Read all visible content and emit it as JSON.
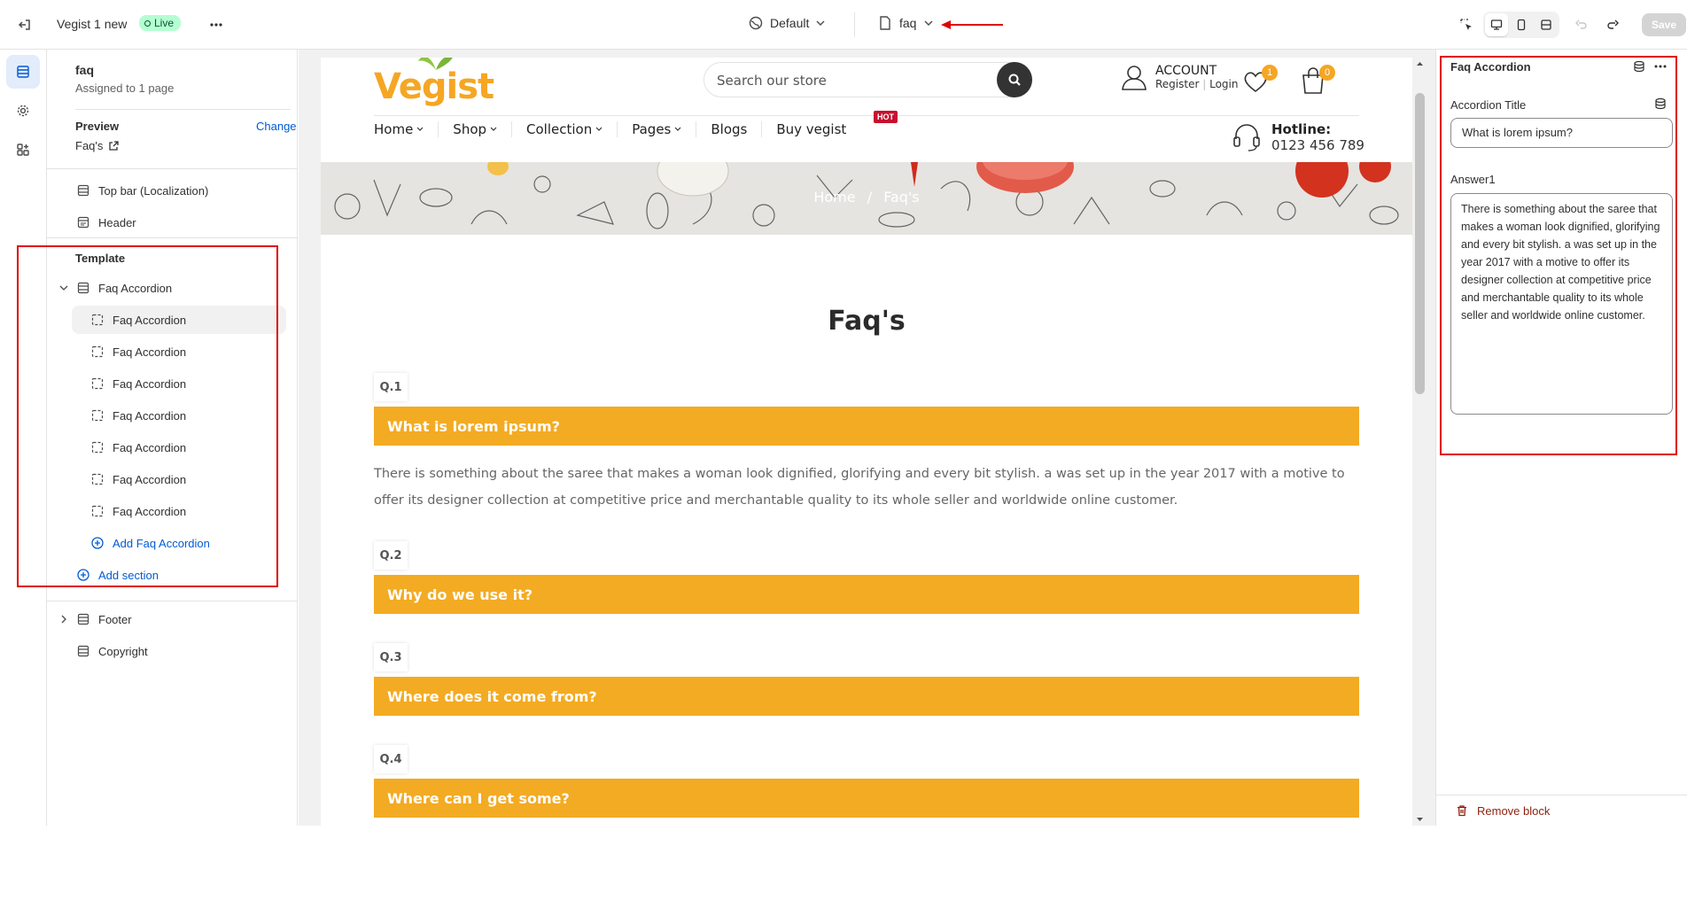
{
  "topbar": {
    "theme_name": "Vegist 1 new",
    "live_label": "Live",
    "language_label": "Default",
    "page_label": "faq",
    "save_label": "Save"
  },
  "sections_panel": {
    "page_title": "faq",
    "assigned": "Assigned to 1 page",
    "preview_label": "Preview",
    "change_label": "Change",
    "preview_page": "Faq's",
    "top_bar": "Top bar (Localization)",
    "header": "Header",
    "template_label": "Template",
    "section_name": "Faq Accordion",
    "blocks": [
      "Faq Accordion",
      "Faq Accordion",
      "Faq Accordion",
      "Faq Accordion",
      "Faq Accordion",
      "Faq Accordion",
      "Faq Accordion"
    ],
    "add_block": "Add Faq Accordion",
    "add_section": "Add section",
    "footer": "Footer",
    "copyright": "Copyright"
  },
  "store": {
    "logo": "Vegist",
    "search_placeholder": "Search our store",
    "account_title": "ACCOUNT",
    "register": "Register",
    "login": "Login",
    "wishlist_count": "1",
    "cart_count": "0",
    "nav": [
      "Home",
      "Shop",
      "Collection",
      "Pages",
      "Blogs",
      "Buy vegist"
    ],
    "hot_badge": "HOT",
    "hotline_title": "Hotline:",
    "hotline_number": "0123 456 789",
    "breadcrumb_home": "Home",
    "breadcrumb_sep": "/",
    "breadcrumb_current": "Faq's",
    "faq_title": "Faq's",
    "questions": [
      {
        "label": "Q.1",
        "title": "What is lorem ipsum?"
      },
      {
        "label": "Q.2",
        "title": "Why do we use it?"
      },
      {
        "label": "Q.3",
        "title": "Where does it come from?"
      },
      {
        "label": "Q.4",
        "title": "Where can I get some?"
      }
    ],
    "answer1": "There is something about the saree that makes a woman look dignified, glorifying and every bit stylish. a was set up in the year 2017 with a motive to offer its designer collection at competitive price and merchantable quality to its whole seller and worldwide online customer."
  },
  "settings": {
    "block_title": "Faq Accordion",
    "title_label": "Accordion Title",
    "title_value": "What is lorem ipsum?",
    "answer_label": "Answer1",
    "answer_value": "There is something about the saree that makes a woman look dignified, glorifying and every bit stylish. a was set up in the year 2017 with a motive to offer its designer collection at competitive price and merchantable quality to its whole seller and worldwide online customer.",
    "remove_label": "Remove block"
  },
  "colors": {
    "accent": "#f3ab23",
    "link": "#005bd3",
    "annotation": "#e00000",
    "danger": "#8e1f0b"
  }
}
